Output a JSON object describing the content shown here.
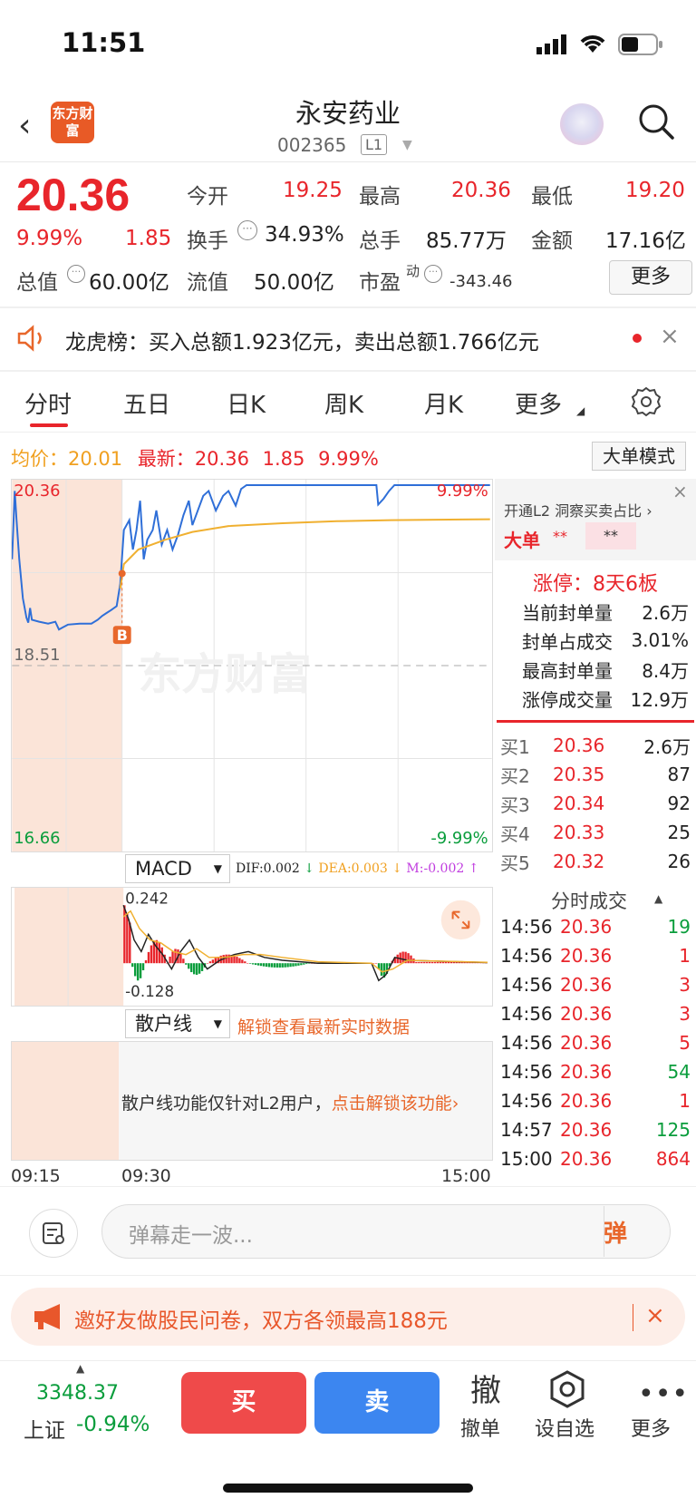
{
  "status": {
    "time": "11:51"
  },
  "header": {
    "title": "永安药业",
    "logo_text": "东方财富",
    "code": "002365",
    "level": "L1"
  },
  "quote": {
    "price": "20.36",
    "change_pct": "9.99%",
    "change": "1.85",
    "open_label": "今开",
    "open": "19.25",
    "high_label": "最高",
    "high": "20.36",
    "low_label": "最低",
    "low": "19.20",
    "turnover_label": "换手",
    "turnover": "34.93%",
    "volume_label": "总手",
    "volume": "85.77万",
    "amount_label": "金额",
    "amount": "17.16亿",
    "mktcap_label": "总值",
    "mktcap": "60.00亿",
    "float_label": "流值",
    "float": "50.00亿",
    "pe_label": "市盈",
    "pe_sup": "动",
    "pe": "-343.46",
    "more": "更多"
  },
  "dragon": {
    "text": "龙虎榜：买入总额1.923亿元，卖出总额1.766亿元"
  },
  "tabs": [
    "分时",
    "五日",
    "日K",
    "周K",
    "月K",
    "更多"
  ],
  "info": {
    "avg_label": "均价：",
    "avg": "20.01",
    "latest_label": "最新：",
    "latest": "20.36",
    "change": "1.85",
    "pct": "9.99%",
    "big_order": "大单模式"
  },
  "chart": {
    "y_top": "20.36",
    "y_mid": "18.51",
    "y_bottom": "16.66",
    "pct_top": "9.99%",
    "pct_bottom": "-9.99%",
    "watermark": "东方财富",
    "marker": "B",
    "times": [
      "09:15",
      "09:30",
      "15:00"
    ]
  },
  "chart_data": {
    "type": "line",
    "title": "",
    "x": [
      "09:15",
      "09:30",
      "15:00"
    ],
    "series": [
      {
        "name": "",
        "values": [
          20.36,
          18.92,
          20.36
        ]
      },
      {
        "name": "均价",
        "values": [
          18.92,
          20.01
        ]
      }
    ],
    "ylim": [
      16.66,
      20.36
    ],
    "reference": 18.51
  },
  "macd": {
    "label": "MACD",
    "dif": "DIF:0.002",
    "dea": "DEA:0.003",
    "m": "M:-0.002",
    "top": "0.242",
    "bottom": "-0.128"
  },
  "retail": {
    "label": "散户线",
    "unlock": "解锁查看最新实时数据",
    "msg": "散户线功能仅针对L2用户，",
    "link": "点击解锁该功能"
  },
  "l2": {
    "promo": "开通L2 洞察买卖占比",
    "big_label": "大单",
    "big_val1": "**",
    "big_val2": "**",
    "limit": "涨停：8天6板",
    "rows": [
      {
        "label": "当前封单量",
        "value": "2.6万"
      },
      {
        "label": "封单占成交",
        "value": "3.01%"
      },
      {
        "label": "最高封单量",
        "value": "8.4万"
      },
      {
        "label": "涨停成交量",
        "value": "12.9万"
      }
    ]
  },
  "orderbook": [
    {
      "label": "买1",
      "price": "20.36",
      "vol": "2.6万"
    },
    {
      "label": "买2",
      "price": "20.35",
      "vol": "87"
    },
    {
      "label": "买3",
      "price": "20.34",
      "vol": "92"
    },
    {
      "label": "买4",
      "price": "20.33",
      "vol": "25"
    },
    {
      "label": "买5",
      "price": "20.32",
      "vol": "26"
    }
  ],
  "trades_title": "分时成交",
  "trades": [
    {
      "time": "14:56",
      "price": "20.36",
      "vol": "19",
      "color": "green"
    },
    {
      "time": "14:56",
      "price": "20.36",
      "vol": "1",
      "color": "red"
    },
    {
      "time": "14:56",
      "price": "20.36",
      "vol": "3",
      "color": "red"
    },
    {
      "time": "14:56",
      "price": "20.36",
      "vol": "3",
      "color": "red"
    },
    {
      "time": "14:56",
      "price": "20.36",
      "vol": "5",
      "color": "red"
    },
    {
      "time": "14:56",
      "price": "20.36",
      "vol": "54",
      "color": "green"
    },
    {
      "time": "14:56",
      "price": "20.36",
      "vol": "1",
      "color": "red"
    },
    {
      "time": "14:57",
      "price": "20.36",
      "vol": "125",
      "color": "green"
    },
    {
      "time": "15:00",
      "price": "20.36",
      "vol": "864",
      "color": "red"
    }
  ],
  "comment": {
    "placeholder": "弹幕走一波...",
    "dan": "弹"
  },
  "survey": {
    "text": "邀好友做股民问卷，双方各领最高188元"
  },
  "bottom": {
    "index_value": "3348.37",
    "index_name": "上证",
    "index_pct": "-0.94%",
    "buy": "买",
    "sell": "卖",
    "cancel_icon": "撤",
    "cancel": "撤单",
    "watch": "设自选",
    "more": "更多"
  }
}
